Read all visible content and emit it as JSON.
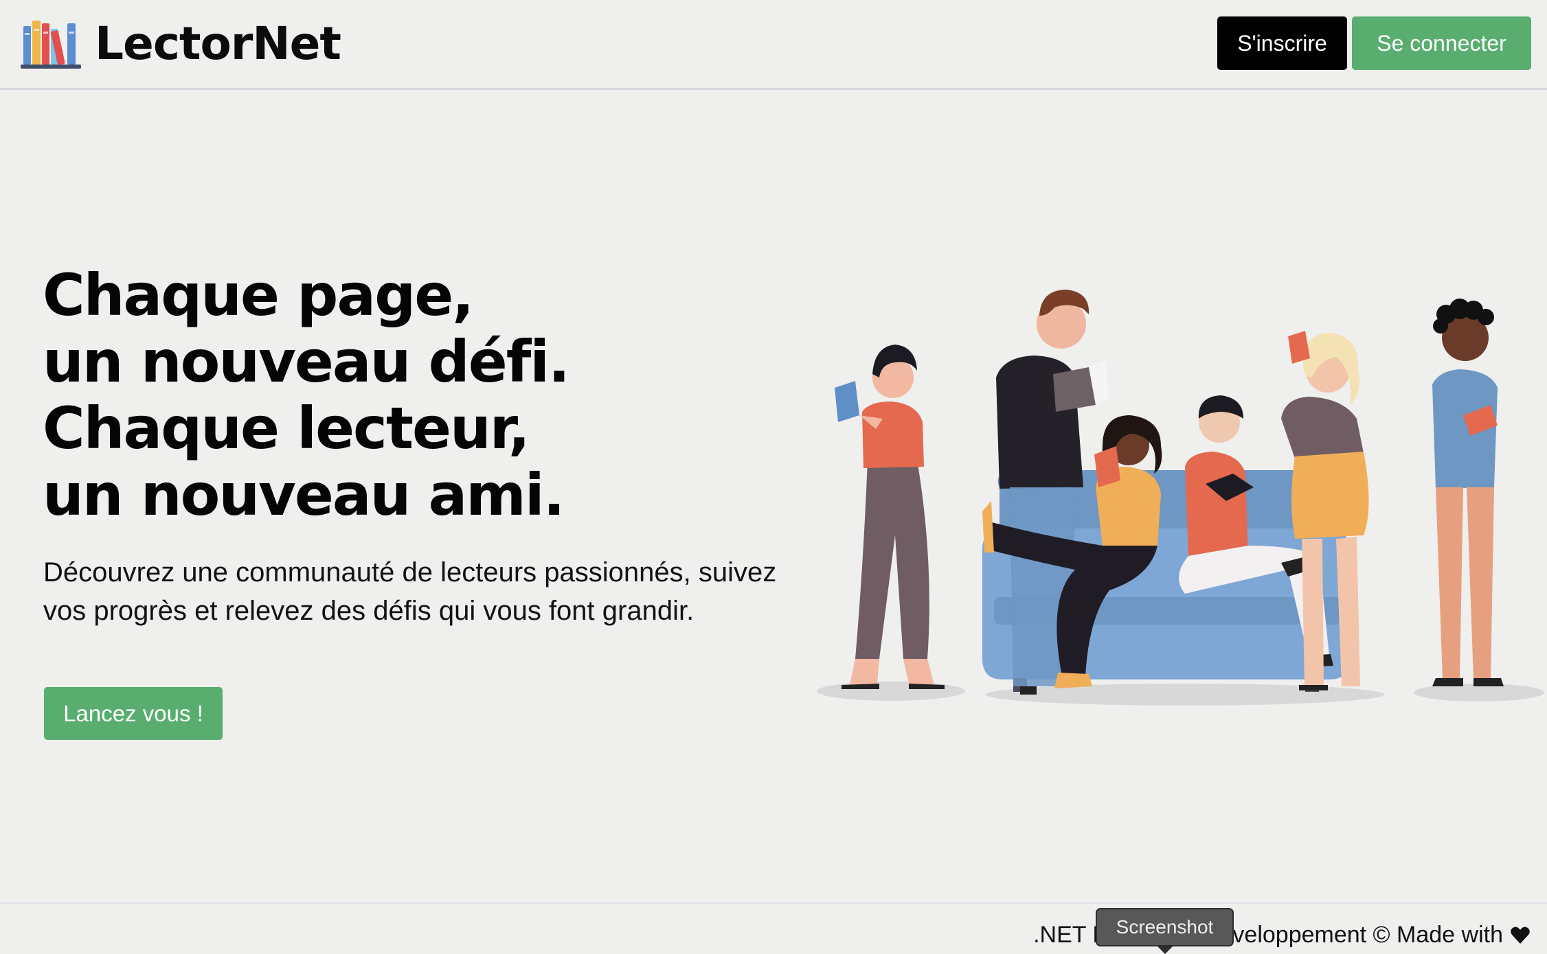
{
  "header": {
    "brand_name": "LectorNet",
    "logo_icon": "books-icon",
    "signup_label": "S'inscrire",
    "login_label": "Se connecter"
  },
  "hero": {
    "title_lines": [
      "Chaque page,",
      "un nouveau défi.",
      "Chaque lecteur,",
      "un nouveau ami."
    ],
    "subtitle": "Découvrez une communauté de lecteurs passionnés, suivez vos progrès et relevez des défis qui vous font grandir.",
    "cta_label": "Lancez vous !",
    "illustration_icon": "people-reading-illustration"
  },
  "footer": {
    "text": ".NET Full-Stack Developpement © Made with",
    "heart_icon": "heart-icon"
  },
  "tooltip": {
    "label": "Screenshot"
  },
  "colors": {
    "background": "#efefed",
    "accent_green": "#58ad6f",
    "signup_black": "#000000"
  }
}
